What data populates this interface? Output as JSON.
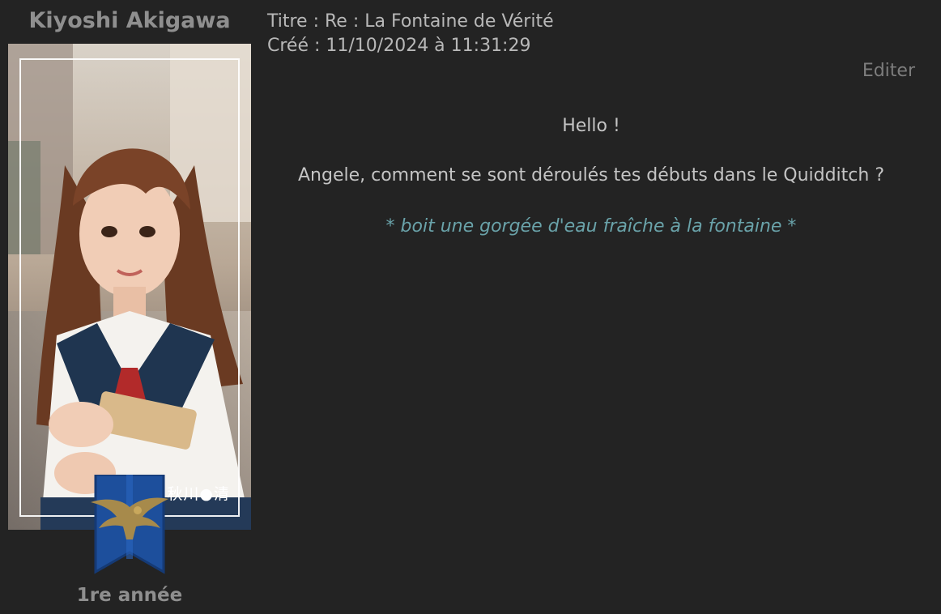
{
  "author": {
    "name": "Kiyoshi Akigawa",
    "avatar_signature": "秋川●清",
    "year": "1re année",
    "house_banner_color": "#1d4f9c"
  },
  "post": {
    "title_line": "Titre : Re : La Fontaine de Vérité",
    "created_line": "Créé : 11/10/2024 à 11:31:29",
    "edit_label": "Editer",
    "greeting": "Hello !",
    "question": "Angele, comment se sont déroulés tes débuts dans le Quidditch ?",
    "action": "* boit une gorgée d'eau fraîche à la fontaine *"
  },
  "colors": {
    "background": "#232323",
    "action_text": "#6aa3aa"
  }
}
